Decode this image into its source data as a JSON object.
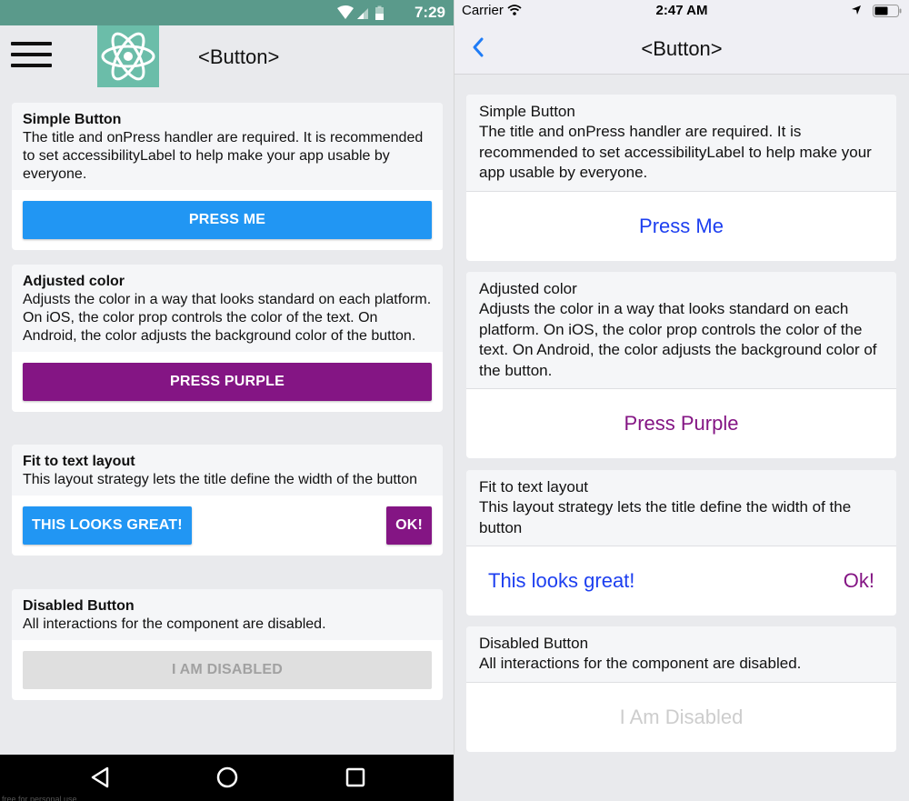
{
  "android": {
    "status_bar": {
      "time": "7:29",
      "icons": [
        "wifi-icon",
        "cell-signal-icon",
        "battery-icon"
      ]
    },
    "toolbar": {
      "menu_icon": "hamburger-menu-icon",
      "logo_icon": "react-atom-icon",
      "title": "<Button>"
    },
    "sections": [
      {
        "title": "Simple Button",
        "description": "The title and onPress handler are required. It is recommended to set accessibilityLabel to help make your app usable by everyone.",
        "buttons": [
          {
            "label": "PRESS ME",
            "color": "#2196f3"
          }
        ]
      },
      {
        "title": "Adjusted color",
        "description": "Adjusts the color in a way that looks standard on each platform. On iOS, the color prop controls the color of the text. On Android, the color adjusts the background color of the button.",
        "buttons": [
          {
            "label": "PRESS PURPLE",
            "color": "#841584"
          }
        ]
      },
      {
        "title": "Fit to text layout",
        "description": "This layout strategy lets the title define the width of the button",
        "buttons": [
          {
            "label": "THIS LOOKS GREAT!",
            "color": "#2196f3"
          },
          {
            "label": "OK!",
            "color": "#841584"
          }
        ]
      },
      {
        "title": "Disabled Button",
        "description": "All interactions for the component are disabled.",
        "buttons": [
          {
            "label": "I AM DISABLED",
            "color": "#dfdfdf",
            "disabled": true
          }
        ]
      }
    ],
    "nav_bar": {
      "back": "back-triangle-icon",
      "home": "home-circle-icon",
      "recents": "recents-square-icon"
    },
    "watermark": "free for personal use"
  },
  "ios": {
    "status_bar": {
      "carrier": "Carrier",
      "time": "2:47 AM",
      "icons": [
        "wifi-icon",
        "location-arrow-icon",
        "battery-icon"
      ]
    },
    "nav": {
      "back_icon": "chevron-left-icon",
      "title": "<Button>"
    },
    "sections": [
      {
        "title": "Simple Button",
        "description": "The title and onPress handler are required. It is recommended to set accessibilityLabel to help make your app usable by everyone.",
        "buttons": [
          {
            "label": "Press Me",
            "color": "#1d3ff0"
          }
        ]
      },
      {
        "title": "Adjusted color",
        "description": "Adjusts the color in a way that looks standard on each platform. On iOS, the color prop controls the color of the text. On Android, the color adjusts the background color of the button.",
        "buttons": [
          {
            "label": "Press Purple",
            "color": "#841584"
          }
        ]
      },
      {
        "title": "Fit to text layout",
        "description": "This layout strategy lets the title define the width of the button",
        "buttons": [
          {
            "label": "This looks great!",
            "color": "#1d3ff0"
          },
          {
            "label": "Ok!",
            "color": "#841584"
          }
        ]
      },
      {
        "title": "Disabled Button",
        "description": "All interactions for the component are disabled.",
        "buttons": [
          {
            "label": "I Am Disabled",
            "color": "#cdcdcd",
            "disabled": true
          }
        ]
      }
    ]
  },
  "colors": {
    "android_status": "#5a9a8b",
    "android_logo_bg": "#6bbda9",
    "ios_tint": "#1f7cf6",
    "page_bg": "#e9eaed"
  }
}
